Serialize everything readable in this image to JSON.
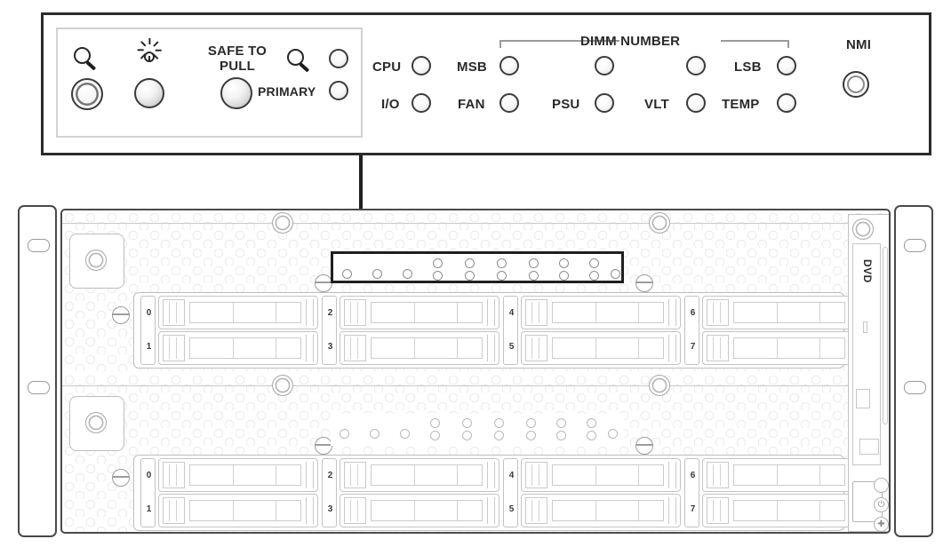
{
  "diagram": {
    "title": "Server front panel and chassis front view",
    "callout": {
      "controls": {
        "locate_button": {
          "icon": "magnifier-icon",
          "label": ""
        },
        "brightness_button": {
          "icon": "sun-icon",
          "label": ""
        },
        "safe_to_pull": {
          "label": "SAFE TO\nPULL"
        },
        "locate_led": {
          "icon": "magnifier-icon"
        },
        "primary": {
          "label": "PRIMARY"
        }
      },
      "leds": {
        "row1": [
          {
            "label": "CPU"
          },
          {
            "label": "MSB"
          },
          {
            "label": ""
          },
          {
            "label": ""
          },
          {
            "label": "LSB"
          }
        ],
        "row2": [
          {
            "label": "I/O"
          },
          {
            "label": "FAN"
          },
          {
            "label": "PSU"
          },
          {
            "label": "VLT"
          },
          {
            "label": "TEMP"
          }
        ],
        "group_label": "DIMM NUMBER"
      },
      "nmi": {
        "label": "NMI"
      }
    },
    "chassis": {
      "upper_unit": {
        "drive_bays": [
          "0",
          "1",
          "2",
          "3",
          "4",
          "5",
          "6",
          "7"
        ],
        "strip_highlighted": true
      },
      "lower_unit": {
        "drive_bays": [
          "0",
          "1",
          "2",
          "3",
          "4",
          "5",
          "6",
          "7"
        ],
        "strip_highlighted": false
      },
      "optical": {
        "label": "DVD"
      }
    },
    "colors": {
      "outline_dark": "#2b2b2b",
      "outline_mid": "#4a4a4a",
      "outline_light": "#c4c4c4",
      "highlight": "#1f1f1f",
      "background": "#ffffff"
    }
  }
}
